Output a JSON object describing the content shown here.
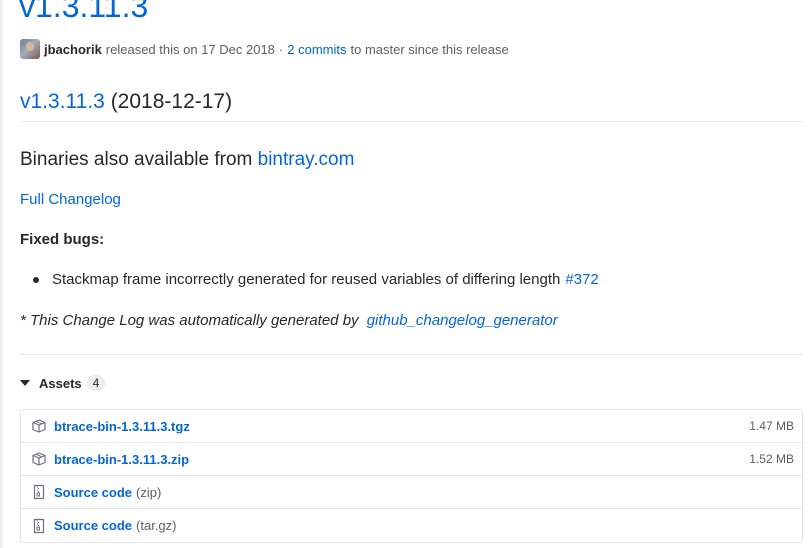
{
  "release": {
    "title": "v1.3.11.3",
    "author": "jbachorik",
    "released_text": "released this on 17 Dec 2018",
    "separator": "·",
    "commits_link": "2 commits",
    "since_text": "to master since this release"
  },
  "body": {
    "heading_version": "v1.3.11.3",
    "heading_date": "(2018-12-17)",
    "binaries_text": "Binaries also available from",
    "binaries_link": "bintray.com",
    "full_changelog": "Full Changelog",
    "fixed_bugs_label": "Fixed bugs:",
    "bug_text": "Stackmap frame incorrectly generated for reused variables of differing length",
    "bug_link": "#372",
    "generated_text": "* This Change Log was automatically generated by",
    "generated_link": "github_changelog_generator"
  },
  "assets": {
    "label": "Assets",
    "count": "4",
    "items": [
      {
        "name": "btrace-bin-1.3.11.3.tgz",
        "size": "1.47 MB",
        "icon": "package-icon"
      },
      {
        "name": "btrace-bin-1.3.11.3.zip",
        "size": "1.52 MB",
        "icon": "package-icon"
      },
      {
        "name": "Source code",
        "format": "(zip)",
        "icon": "file-zip-icon"
      },
      {
        "name": "Source code",
        "format": "(tar.gz)",
        "icon": "file-zip-icon"
      }
    ]
  },
  "colors": {
    "link": "#0366d6",
    "text": "#24292e",
    "muted": "#586069",
    "border": "#e1e4e8"
  }
}
